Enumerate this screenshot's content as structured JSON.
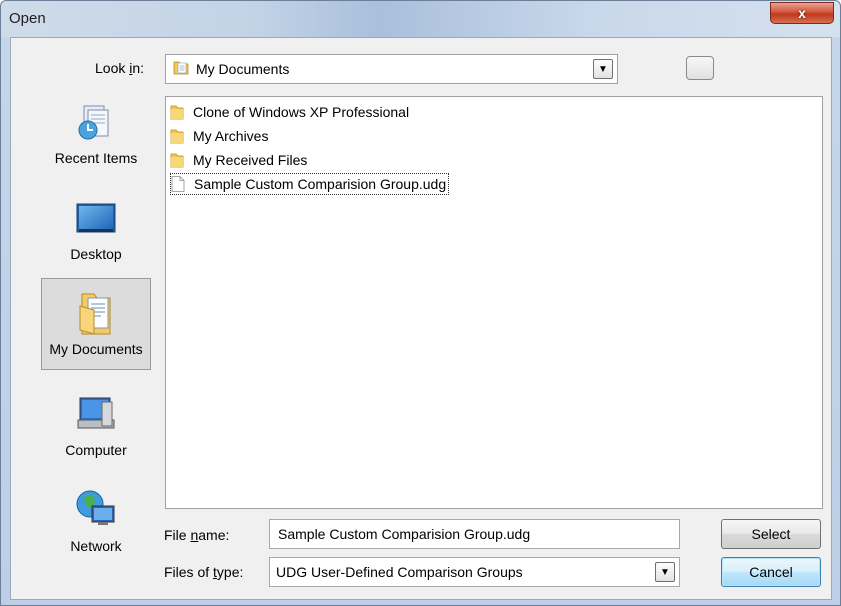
{
  "window": {
    "title": "Open",
    "close_glyph": "x"
  },
  "lookin": {
    "label_pre": "Look ",
    "label_accel": "i",
    "label_post": "n:",
    "value": "My Documents"
  },
  "places": [
    {
      "label": "Recent Items",
      "icon": "recent-items-icon"
    },
    {
      "label": "Desktop",
      "icon": "desktop-icon"
    },
    {
      "label": "My Documents",
      "icon": "my-documents-icon",
      "selected": true
    },
    {
      "label": "Computer",
      "icon": "computer-icon"
    },
    {
      "label": "Network",
      "icon": "network-icon"
    }
  ],
  "files": [
    {
      "name": "Clone of Windows XP Professional",
      "type": "folder"
    },
    {
      "name": "My Archives",
      "type": "folder"
    },
    {
      "name": "My Received Files",
      "type": "folder"
    },
    {
      "name": "Sample Custom Comparision Group.udg",
      "type": "file",
      "focused": true
    }
  ],
  "filename": {
    "label_pre": "File ",
    "label_accel": "n",
    "label_post": "ame:",
    "value": "Sample Custom Comparision Group.udg"
  },
  "filetype": {
    "label_pre": "Files of ",
    "label_accel": "t",
    "label_post": "ype:",
    "value": "UDG User-Defined Comparison Groups"
  },
  "buttons": {
    "select": "Select",
    "cancel": "Cancel"
  }
}
